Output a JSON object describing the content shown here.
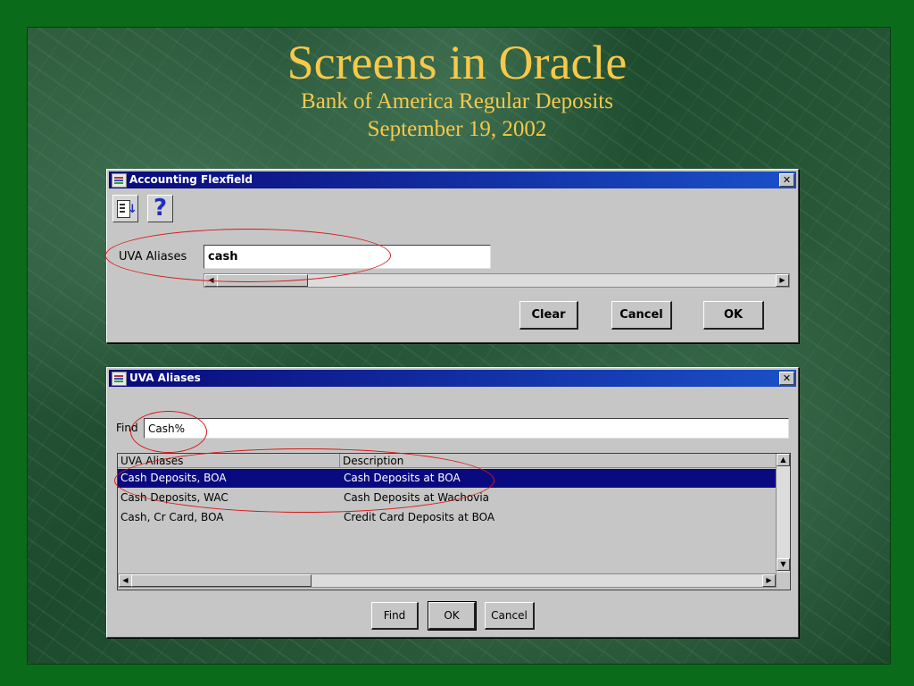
{
  "slide": {
    "title": "Screens in Oracle",
    "subtitle": "Bank of America Regular Deposits",
    "date": "September 19, 2002"
  },
  "flexfield_window": {
    "title": "Accounting Flexfield",
    "field_label": "UVA Aliases",
    "field_value": "cash",
    "buttons": {
      "clear": "Clear",
      "cancel": "Cancel",
      "ok": "OK"
    }
  },
  "aliases_window": {
    "title": "UVA Aliases",
    "find_label": "Find",
    "find_value": "Cash%",
    "columns": [
      "UVA Aliases",
      "Description"
    ],
    "rows": [
      {
        "alias": "Cash Deposits, BOA",
        "description": "Cash Deposits at BOA",
        "selected": true
      },
      {
        "alias": "Cash Deposits, WAC",
        "description": "Cash Deposits at Wachovia",
        "selected": false
      },
      {
        "alias": "Cash, Cr Card, BOA",
        "description": "Credit Card Deposits at BOA",
        "selected": false
      }
    ],
    "buttons": {
      "find": "Find",
      "ok": "OK",
      "cancel": "Cancel"
    }
  },
  "colors": {
    "slide_border": "#0a6b1a",
    "title_text": "#f7c94a",
    "selection": "#0a0a80",
    "annotation": "#d81818"
  }
}
